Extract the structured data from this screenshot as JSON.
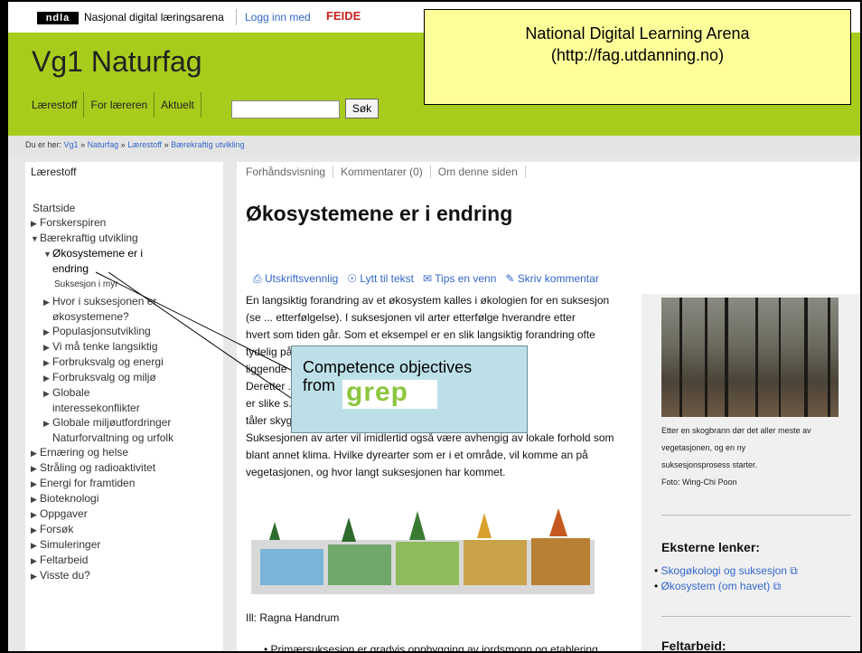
{
  "header": {
    "logo_text": "ndla",
    "site_name": "Nasjonal digital læringsarena",
    "login_label": "Logg inn med",
    "feide_label": "FEIDE",
    "title": "Vg1 Naturfag",
    "nav": [
      "Lærestoff",
      "For læreren",
      "Aktuelt"
    ],
    "search_placeholder": "",
    "search_button": "Søk"
  },
  "callout_top": {
    "line1": "National Digital Learning Arena",
    "line2": "(http://fag.utdanning.no)"
  },
  "breadcrumb": {
    "prefix": "Du er her:",
    "items": [
      "Vg1",
      "Naturfag",
      "Lærestoff",
      "Bærekraftig utvikling"
    ],
    "sep": "»"
  },
  "sidebar": {
    "title": "Lærestoff",
    "items": [
      {
        "label": "Startside",
        "level": 0,
        "arrow": ""
      },
      {
        "label": "Forskerspiren",
        "level": 0,
        "arrow": "right"
      },
      {
        "label": "Bærekraftig utvikling",
        "level": 0,
        "arrow": "down"
      },
      {
        "label": "Økosystemene er i",
        "level": 1,
        "arrow": "down",
        "active": true
      },
      {
        "label": "endring",
        "level": 1,
        "arrow": "",
        "active": true,
        "cont": true
      },
      {
        "label": "Suksesjon i myr",
        "level": 2,
        "arrow": ""
      },
      {
        "label": "Hvor i suksesjonen er",
        "level": 1,
        "arrow": "right"
      },
      {
        "label": "økosystemene?",
        "level": 1,
        "arrow": "",
        "cont": true
      },
      {
        "label": "Populasjonsutvikling",
        "level": 1,
        "arrow": "right"
      },
      {
        "label": "Vi må tenke langsiktig",
        "level": 1,
        "arrow": "right"
      },
      {
        "label": "Forbruksvalg og energi",
        "level": 1,
        "arrow": "right"
      },
      {
        "label": "Forbruksvalg og miljø",
        "level": 1,
        "arrow": "right"
      },
      {
        "label": "Globale",
        "level": 1,
        "arrow": "right"
      },
      {
        "label": "interessekonflikter",
        "level": 1,
        "arrow": "",
        "cont": true
      },
      {
        "label": "Globale miljøutfordringer",
        "level": 1,
        "arrow": "right"
      },
      {
        "label": "Naturforvaltning og urfolk",
        "level": 1,
        "arrow": "",
        "cont": true
      },
      {
        "label": "Ernæring og helse",
        "level": 0,
        "arrow": "right"
      },
      {
        "label": "Stråling og radioaktivitet",
        "level": 0,
        "arrow": "right"
      },
      {
        "label": "Energi for framtiden",
        "level": 0,
        "arrow": "right"
      },
      {
        "label": "Bioteknologi",
        "level": 0,
        "arrow": "right"
      },
      {
        "label": "Oppgaver",
        "level": 0,
        "arrow": "right"
      },
      {
        "label": "Forsøk",
        "level": 0,
        "arrow": "right"
      },
      {
        "label": "Simuleringer",
        "level": 0,
        "arrow": "right"
      },
      {
        "label": "Feltarbeid",
        "level": 0,
        "arrow": "right"
      },
      {
        "label": "Visste du?",
        "level": 0,
        "arrow": "right"
      }
    ]
  },
  "main": {
    "tabs": [
      "Forhåndsvisning",
      "Kommentarer (0)",
      "Om denne siden"
    ],
    "heading": "Økosystemene er i endring",
    "tools": {
      "print": "Utskriftsvennlig",
      "listen": "Lytt til tekst",
      "tip": "Tips en venn",
      "comment": "Skriv kommentar"
    },
    "article_lines": [
      "En langsiktig forandring av et økosystem kalles i økologien for en suksesjon",
      "(se ... etterfølgelse). I suksesjonen vil arter etterfølge hverandre etter",
      "hvert som tiden går. Som et eksempel er en slik langsiktig forandring ofte",
      "tydelig på ... mark som blir",
      "liggende ... plantearter.",
      "Deretter ... første treslagene",
      "er slike s... mmer treslag som",
      "tåler skyg... og eik.",
      "Suksesjonen av arter vil imidlertid også være avhengig av lokale forhold som",
      "blant annet klima. Hvilke dyrearter som er i et område, vil komme an på",
      "vegetasjonen, og hvor langt suksesjonen har kommet."
    ],
    "illustration_caption": "Ill: Ragna Handrum",
    "bullet_first": "Primærsuksesjon er gradvis oppbygging av jordsmonn og etablering"
  },
  "rightcol": {
    "caption_lines": [
      "Etter en skogbrann dør det aller meste av",
      "vegetasjonen, og en ny",
      "suksesjonsprosess starter.",
      "Foto: Wing-Chi Poon"
    ],
    "external_heading": "Eksterne lenker:",
    "external_links": [
      "Skogøkologi og suksesjon",
      "Økosystem (om havet)"
    ],
    "field_heading": "Feltarbeid:"
  },
  "callout_grep": {
    "line1": "Competence objectives",
    "line2": "from",
    "logo_text": "grep"
  },
  "colors": {
    "header_green": "#a8cc1c",
    "link_blue": "#3366cc",
    "callout_yellow": "#ffff99",
    "callout_blue": "#bde0e8",
    "grep_green": "#8cc63e"
  }
}
